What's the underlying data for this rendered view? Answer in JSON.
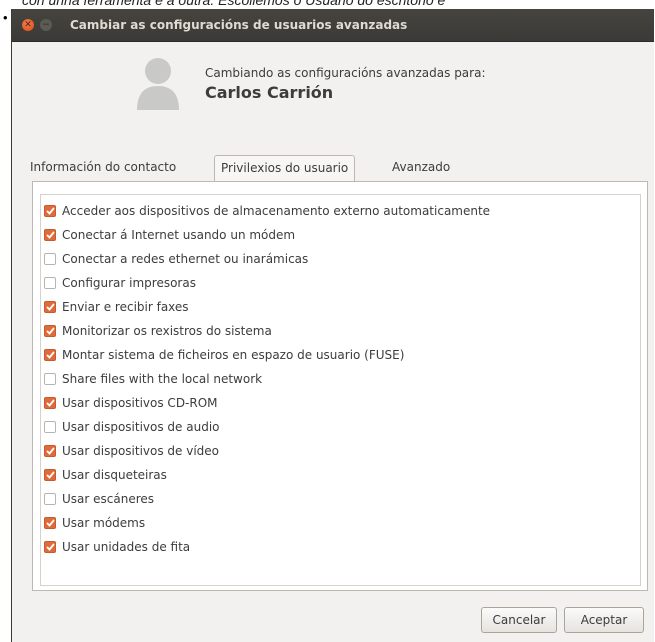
{
  "caption": "con unha ferramenta e a outra. Escollemos o Usuario do escritorio e",
  "window": {
    "title": "Cambiar as configuracións de usuarios avanzadas"
  },
  "header": {
    "subtitle": "Cambiando as configuracións avanzadas para:",
    "user_name": "Carlos Carrión"
  },
  "tabs": [
    {
      "label": "Información do contacto",
      "active": false
    },
    {
      "label": "Privilexios do usuario",
      "active": true
    },
    {
      "label": "Avanzado",
      "active": false
    }
  ],
  "privileges": [
    {
      "label": "Acceder aos dispositivos de almacenamento externo automaticamente",
      "checked": true
    },
    {
      "label": "Conectar á Internet usando un módem",
      "checked": true
    },
    {
      "label": "Conectar a redes ethernet ou inarámicas",
      "checked": false
    },
    {
      "label": "Configurar impresoras",
      "checked": false
    },
    {
      "label": "Enviar e recibir faxes",
      "checked": true
    },
    {
      "label": "Monitorizar os rexistros do sistema",
      "checked": true
    },
    {
      "label": "Montar sistema de ficheiros en espazo de usuario (FUSE)",
      "checked": true
    },
    {
      "label": "Share files with the local network",
      "checked": false
    },
    {
      "label": "Usar dispositivos CD-ROM",
      "checked": true
    },
    {
      "label": "Usar dispositivos de audio",
      "checked": false
    },
    {
      "label": "Usar dispositivos de vídeo",
      "checked": true
    },
    {
      "label": "Usar disqueteiras",
      "checked": true
    },
    {
      "label": "Usar escáneres",
      "checked": false
    },
    {
      "label": "Usar módems",
      "checked": true
    },
    {
      "label": "Usar unidades de fita",
      "checked": true
    }
  ],
  "buttons": {
    "cancel": "Cancelar",
    "accept": "Aceptar"
  },
  "colors": {
    "accent": "#df4a16",
    "titlebar": "#3c3b37",
    "window_bg": "#f2f1f0"
  }
}
